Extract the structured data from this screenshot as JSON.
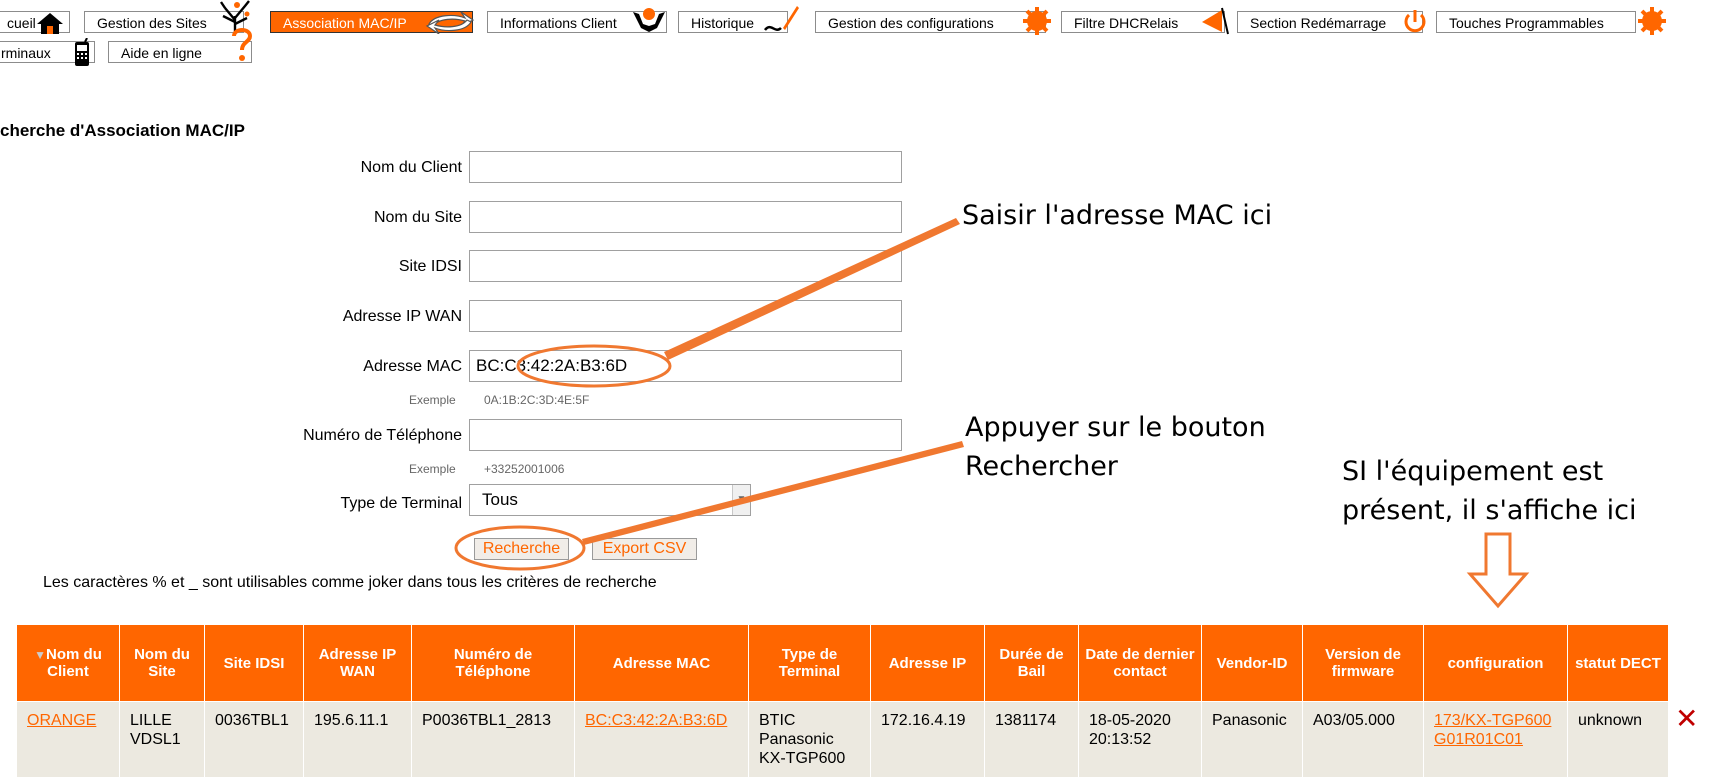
{
  "nav": {
    "row1": [
      {
        "label": "cueil",
        "icon": "house-icon"
      },
      {
        "label": "Gestion des Sites",
        "icon": "tree-icon"
      },
      {
        "label": "Association MAC/IP",
        "icon": "swap-arrows-icon",
        "active": true
      },
      {
        "label": "Informations Client",
        "icon": "person-icon"
      },
      {
        "label": "Historique",
        "icon": "pen-icon"
      },
      {
        "label": "Gestion des configurations",
        "icon": "gear-icon"
      },
      {
        "label": "Filtre DHCRelais",
        "icon": "flag-icon"
      },
      {
        "label": "Section Redémarrage",
        "icon": "power-icon"
      },
      {
        "label": "Touches Programmables",
        "icon": "gear-icon"
      }
    ],
    "row2": [
      {
        "label": "rminaux",
        "icon": "phone-icon"
      },
      {
        "label": "Aide en ligne",
        "icon": "question-icon"
      }
    ]
  },
  "search": {
    "title": "cherche d'Association MAC/IP",
    "fields": {
      "client_name": {
        "label": "Nom du Client",
        "value": ""
      },
      "site_name": {
        "label": "Nom du Site",
        "value": ""
      },
      "site_idsi": {
        "label": "Site IDSI",
        "value": ""
      },
      "wan_ip": {
        "label": "Adresse IP WAN",
        "value": ""
      },
      "mac": {
        "label": "Adresse MAC",
        "value": "BC:C3:42:2A:B3:6D"
      },
      "phone": {
        "label": "Numéro de Téléphone",
        "value": ""
      },
      "terminal_type": {
        "label": "Type de Terminal",
        "value": "Tous"
      }
    },
    "examples": {
      "label": "Exemple",
      "mac": "0A:1B:2C:3D:4E:5F",
      "phone": "+33252001006"
    },
    "search_button": "Recherche",
    "export_button": "Export CSV",
    "note": "Les caractères % et _ sont utilisables comme joker dans tous les critères de recherche"
  },
  "results": {
    "headers": [
      "Nom du Client",
      "Nom du Site",
      "Site IDSI",
      "Adresse IP WAN",
      "Numéro de Téléphone",
      "Adresse MAC",
      "Type de Terminal",
      "Adresse IP",
      "Durée de Bail",
      "Date de dernier contact",
      "Vendor-ID",
      "Version de firmware",
      "configuration",
      "statut DECT"
    ],
    "row": {
      "client": "ORANGE",
      "site": "LILLE VDSL1",
      "idsi": "0036TBL1",
      "wan_ip": "195.6.11.1",
      "phone": "P0036TBL1_2813",
      "mac": "BC:C3:42:2A:B3:6D",
      "terminal": "BTIC Panasonic KX-TGP600",
      "ip": "172.16.4.19",
      "lease": "1381174",
      "last_contact": "18-05-2020 20:13:52",
      "vendor": "Panasonic",
      "firmware": "A03/05.000",
      "config": "173/KX-TGP600 G01R01C01",
      "dect": "unknown"
    },
    "delete_symbol": "✕"
  },
  "annotations": {
    "mac_hint": "Saisir l'adresse MAC ici",
    "button_hint_line1": "Appuyer sur le bouton",
    "button_hint_line2": "Rechercher",
    "result_hint_line1": "SI l'équipement est",
    "result_hint_line2": "présent, il s'affiche ici"
  },
  "colors": {
    "accent": "#ff6600",
    "table_row": "#ece9e0"
  }
}
